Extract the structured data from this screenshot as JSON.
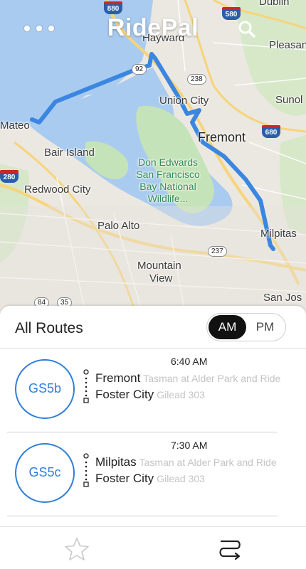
{
  "header": {
    "title": "RidePal",
    "menu_icon": "more-dots-icon",
    "search_icon": "search-icon"
  },
  "map": {
    "labels": {
      "hayward": "Hayward",
      "pleasanton": "Pleasan",
      "union_city": "Union City",
      "sunol": "Sunol",
      "san_mateo": "Mateo",
      "fremont": "Fremont",
      "bair_island": "Bair Island",
      "park": "Don Edwards San Francisco Bay National Wildlife...",
      "park_line1": "Don Edwards",
      "park_line2": "San Francisco",
      "park_line3": "Bay National",
      "park_line4": "Wildlife...",
      "redwood_city": "Redwood City",
      "palo_alto": "Palo Alto",
      "milpitas": "Milpitas",
      "mountain_view_1": "Mountain",
      "mountain_view_2": "View",
      "san_jose": "San Jos",
      "dublin": "Dublin"
    },
    "shields": {
      "i880": "880",
      "i580": "580",
      "r92": "92",
      "r238": "238",
      "i680": "680",
      "i280": "280",
      "r237": "237",
      "r84": "84",
      "r35": "35"
    },
    "route_color": "#3a86e0"
  },
  "routes_panel": {
    "title": "All Routes",
    "toggle": {
      "am": "AM",
      "pm": "PM",
      "selected": "AM"
    },
    "routes": [
      {
        "time": "6:40 AM",
        "code": "GS5b",
        "from_city": "Fremont",
        "from_stop": "Tasman at Alder Park and Ride",
        "to_city": "Foster City",
        "to_stop": "Gilead 303"
      },
      {
        "time": "7:30 AM",
        "code": "GS5c",
        "from_city": "Milpitas",
        "from_stop": "Tasman at Alder Park and Ride",
        "to_city": "Foster City",
        "to_stop": "Gilead 303"
      }
    ]
  },
  "tabbar": {
    "favorites_icon": "star-icon",
    "routes_icon": "route-icon"
  },
  "colors": {
    "accent": "#2e7fd9",
    "water": "#aacbf0",
    "park": "#c5e3b8"
  }
}
